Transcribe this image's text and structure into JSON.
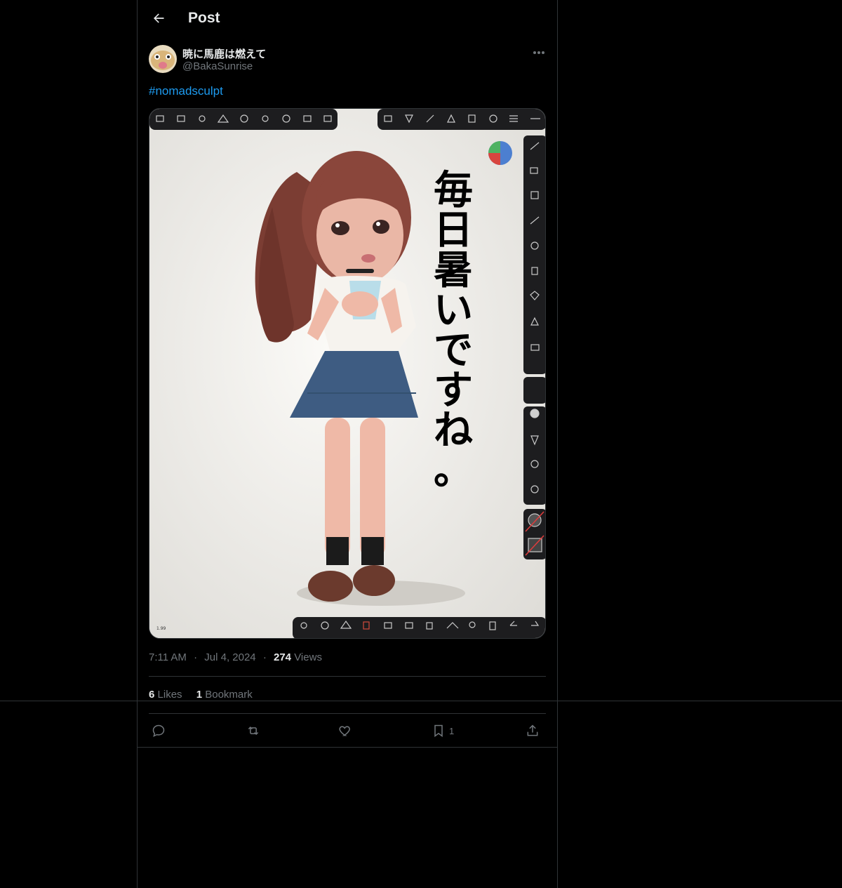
{
  "header": {
    "title": "Post"
  },
  "author": {
    "display_name": "暁に馬鹿は燃えて",
    "handle": "@BakaSunrise"
  },
  "post": {
    "hashtag": "#nomadsculpt",
    "image_overlay_text": [
      "毎",
      "日",
      "暑",
      "い",
      "で",
      "す",
      "ね",
      "。"
    ],
    "time": "7:11 AM",
    "date": "Jul 4, 2024",
    "views_count": "274",
    "views_label": "Views"
  },
  "stats": {
    "likes_count": "6",
    "likes_label": "Likes",
    "bookmarks_count": "1",
    "bookmarks_label": "Bookmark"
  },
  "actions": {
    "bookmark_count": "1"
  },
  "sep": "·",
  "colors": {
    "accent": "#1d9bf0",
    "muted": "#71767b",
    "border": "#2f3336"
  }
}
